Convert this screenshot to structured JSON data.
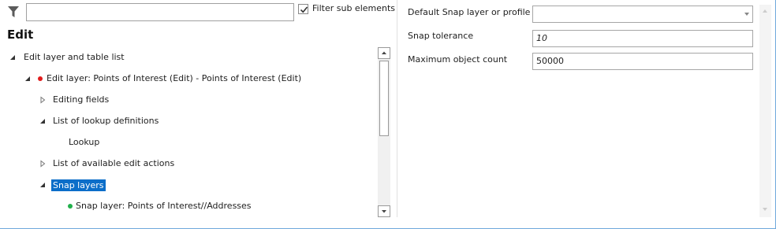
{
  "filter": {
    "placeholder": "",
    "value": "",
    "checkbox_label": "Filter sub elements",
    "checkbox_checked": true
  },
  "section_title": "Edit",
  "tree": [
    {
      "label": "Edit layer and table list",
      "expander": "expanded"
    },
    {
      "label": "Edit layer: Points of Interest (Edit) - Points of Interest (Edit)",
      "expander": "expanded",
      "dot_color": "#e11c1c"
    },
    {
      "label": "Editing fields",
      "expander": "collapsed"
    },
    {
      "label": "List of lookup definitions",
      "expander": "expanded"
    },
    {
      "label": "Lookup",
      "expander": "none"
    },
    {
      "label": "List of available edit actions",
      "expander": "collapsed"
    },
    {
      "label": "Snap layers",
      "expander": "expanded",
      "selected": true
    },
    {
      "label": "Snap layer: Points of Interest//Addresses",
      "expander": "none",
      "dot_color": "#22b04b"
    }
  ],
  "properties": {
    "snap_default": {
      "label": "Default Snap layer or profile",
      "value": ""
    },
    "snap_tolerance": {
      "label": "Snap tolerance",
      "value": "10"
    },
    "max_objects": {
      "label": "Maximum object count",
      "value": "50000"
    }
  },
  "colors": {
    "selection": "#0b6ec9",
    "error_dot": "#e11c1c",
    "ok_dot": "#22b04b"
  },
  "icons": [
    "filter-icon",
    "check-icon",
    "expand-arrow-icon",
    "collapse-arrow-icon",
    "dropdown-arrow-icon",
    "scroll-up-icon",
    "scroll-down-icon"
  ]
}
